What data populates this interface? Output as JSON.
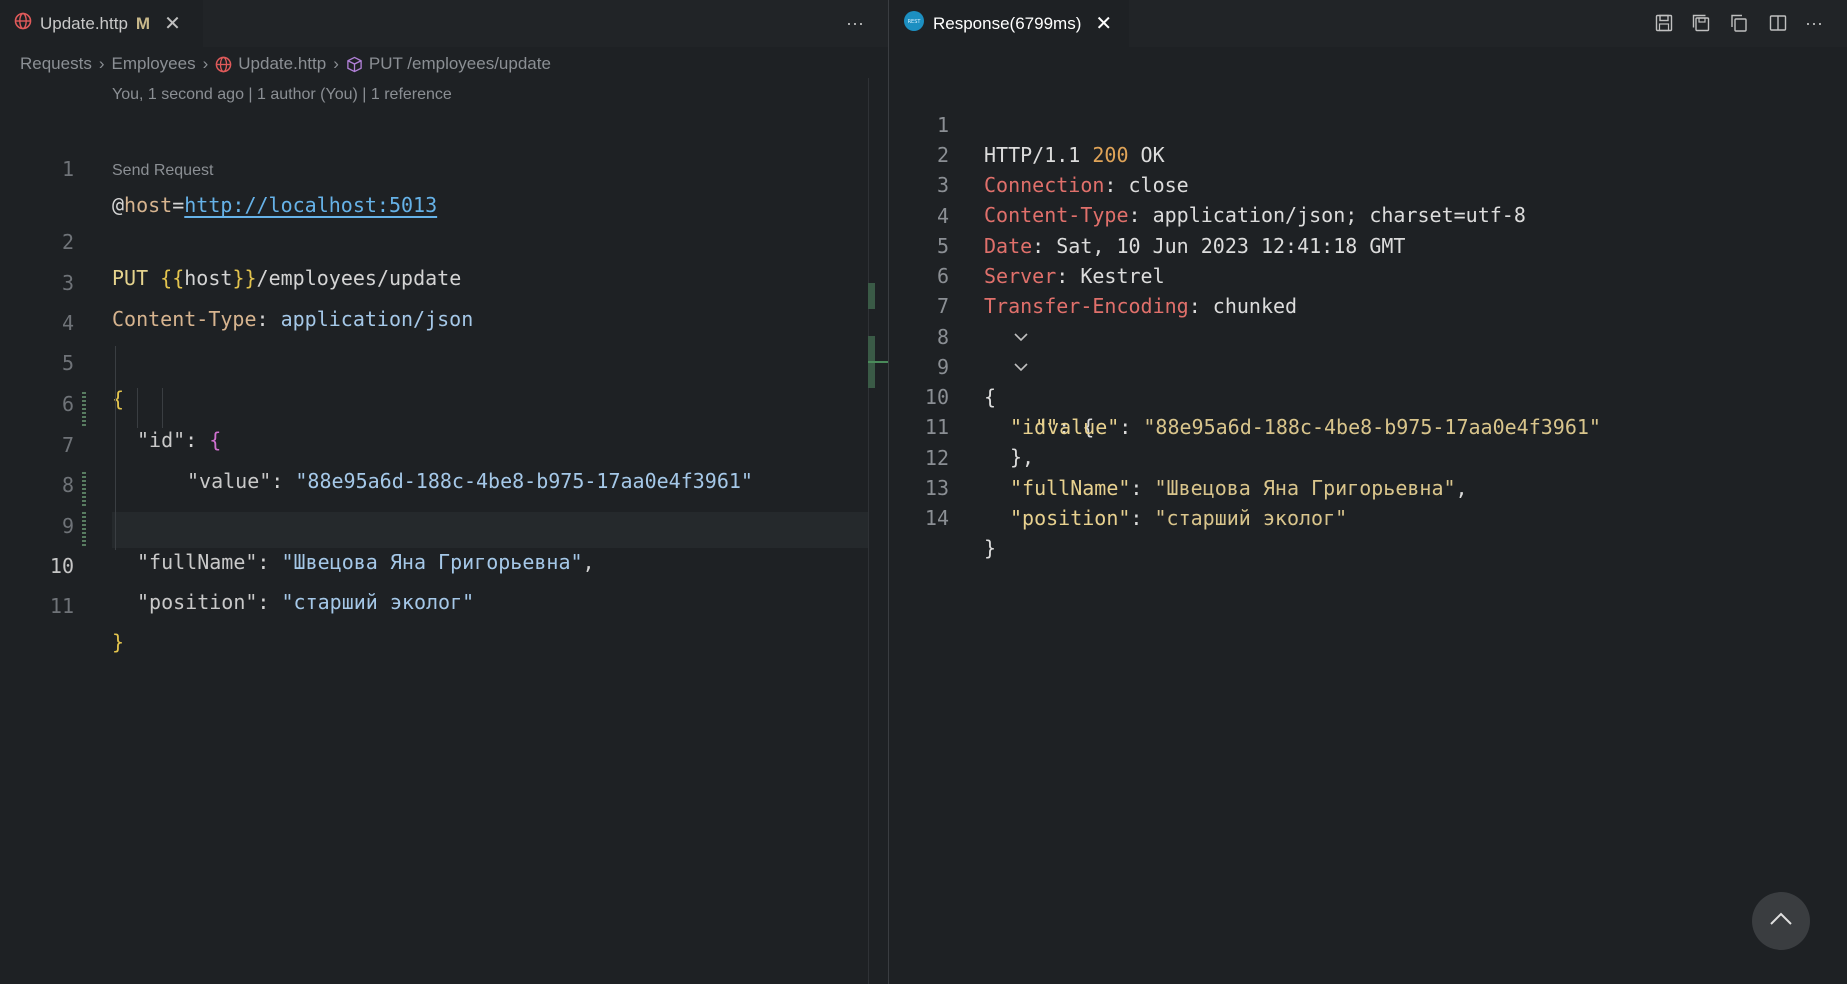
{
  "left_tab": {
    "title": "Update.http",
    "modified": "M",
    "close": "✕",
    "more": "···"
  },
  "breadcrumb": [
    "Requests",
    "Employees",
    "Update.http",
    "PUT /employees/update"
  ],
  "blame": "You, 1 second ago | 1 author (You) | 1 reference",
  "codelens": "Send Request",
  "editor_lines": [
    {
      "n": "1"
    },
    {
      "n": "2"
    },
    {
      "n": "3"
    },
    {
      "n": "4"
    },
    {
      "n": "5"
    },
    {
      "n": "6"
    },
    {
      "n": "7"
    },
    {
      "n": "8"
    },
    {
      "n": "9"
    },
    {
      "n": "10"
    },
    {
      "n": "11"
    }
  ],
  "code": {
    "l1_at": "@",
    "l1_key": "host",
    "l1_eq": "=",
    "l1_url": "http://localhost:5013",
    "l2_method": "PUT ",
    "l2_open": "{{",
    "l2_var": "host",
    "l2_close": "}}",
    "l2_path": "/employees/update",
    "l3_key": "Content-Type",
    "l3_colon": ": ",
    "l3_val": "application/json",
    "l5": "{",
    "l6_key": "\"id\"",
    "l6_colon": ": ",
    "l6_brace": "{",
    "l7_key": "\"value\"",
    "l7_colon": ": ",
    "l7_val": "\"88e95a6d-188c-4be8-b975-17aa0e4f3961\"",
    "l8_brace": "}",
    "l8_comma": ",",
    "l9_key": "\"fullName\"",
    "l9_colon": ": ",
    "l9_val": "\"Швецова Яна Григорьевна\"",
    "l9_comma": ",",
    "l10_key": "\"position\"",
    "l10_colon": ": ",
    "l10_val": "\"старший эколог\"",
    "l11": "}"
  },
  "right_tab": {
    "title": "Response(6799ms)",
    "close": "✕",
    "more": "···"
  },
  "response_lines": [
    {
      "n": "1"
    },
    {
      "n": "2"
    },
    {
      "n": "3"
    },
    {
      "n": "4"
    },
    {
      "n": "5"
    },
    {
      "n": "6"
    },
    {
      "n": "7"
    },
    {
      "n": "8"
    },
    {
      "n": "9"
    },
    {
      "n": "10"
    },
    {
      "n": "11"
    },
    {
      "n": "12"
    },
    {
      "n": "13"
    },
    {
      "n": "14"
    }
  ],
  "response": {
    "r1_proto": "HTTP/1.1 ",
    "r1_code": "200",
    "r1_text": " OK",
    "r2_name": "Connection",
    "r2_val": ": close",
    "r3_name": "Content-Type",
    "r3_val": ": application/json; charset=utf-8",
    "r4_name": "Date",
    "r4_val": ": Sat, 10 Jun 2023 12:41:18 GMT",
    "r5_name": "Server",
    "r5_val": ": Kestrel",
    "r6_name": "Transfer-Encoding",
    "r6_val": ": chunked",
    "r8": "{",
    "r9_key": "\"id\"",
    "r9_rest": ": {",
    "r10_key": "\"value\"",
    "r10_colon": ": ",
    "r10_val": "\"88e95a6d-188c-4be8-b975-17aa0e4f3961\"",
    "r11": "},",
    "r12_key": "\"fullName\"",
    "r12_colon": ": ",
    "r12_val": "\"Швецова Яна Григорьевна\"",
    "r12_comma": ",",
    "r13_key": "\"position\"",
    "r13_colon": ": ",
    "r13_val": "\"старший эколог\"",
    "r14": "}"
  },
  "icons": {
    "http_file": "globe-icon",
    "symbol": "cube-icon",
    "response": "rest-client-icon",
    "save": "save-icon",
    "save_body": "save-body-icon",
    "copy": "copy-icon",
    "split": "split-editor-icon",
    "scroll_top": "chevron-up-icon"
  }
}
